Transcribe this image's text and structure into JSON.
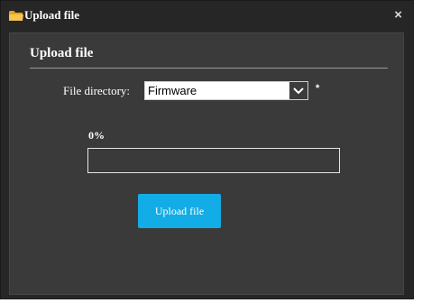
{
  "dialog": {
    "title": "Upload file",
    "close_label": "×"
  },
  "form": {
    "section_title": "Upload file",
    "directory_label": "File directory:",
    "directory_value": "Firmware",
    "required_mark": "*",
    "progress_text": "0%",
    "progress_fraction": 0,
    "upload_button_label": "Upload file"
  },
  "icons": {
    "title_icon": "folder-icon",
    "dropdown_icon": "chevron-down-icon"
  },
  "colors": {
    "accent": "#12ace6",
    "folder": "#f2b632"
  }
}
